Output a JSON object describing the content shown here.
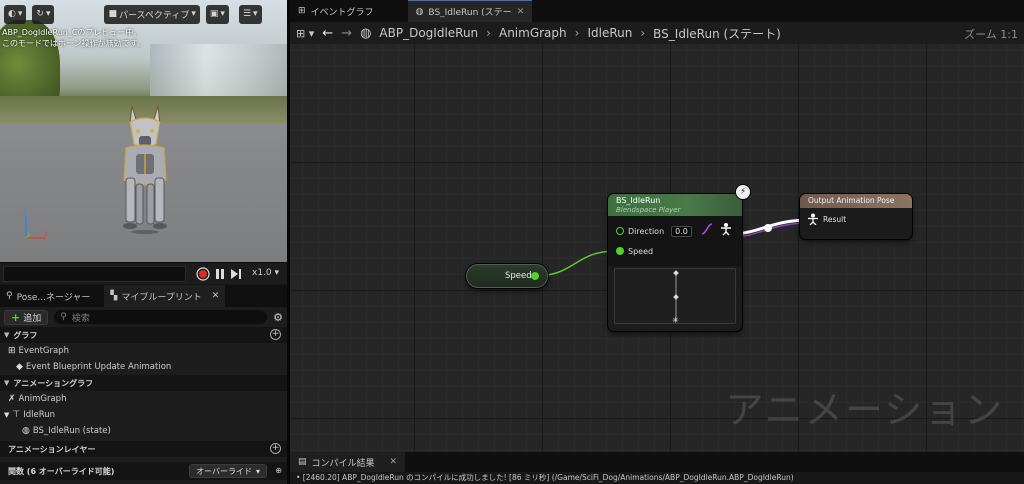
{
  "viewport": {
    "perspective_label": "パースペクティブ",
    "info_line1": "ABP_DogIdleRun_Cのプレビュー中。",
    "info_line2": "このモードではボーン操作が無効です。",
    "playback_speed": "x1.0",
    "axis_z": "Z",
    "axis_x": "X"
  },
  "left_tabs": [
    {
      "label": "Pose...ネージャー"
    },
    {
      "label": "マイブループリント",
      "close": "✕"
    }
  ],
  "my_blueprint": {
    "add_label": "追加",
    "search_placeholder": "検索",
    "sections": {
      "graph": "グラフ",
      "anim_graph": "アニメーショングラフ",
      "anim_layer": "アニメーションレイヤー",
      "functions": "関数 (6 オーバーライド可能)"
    },
    "items": {
      "event_graph": "EventGraph",
      "event_bp_update": "Event Blueprint Update Animation",
      "anim_graph": "AnimGraph",
      "idle_run": "IdleRun",
      "bs_state": "BS_IdleRun (state)"
    },
    "override_label": "オーバーライド"
  },
  "doc_tabs": [
    {
      "label": "イベントグラフ"
    },
    {
      "label": "BS_IdleRun (ステー",
      "close": "✕"
    }
  ],
  "breadcrumb": [
    "ABP_DogIdleRun",
    "AnimGraph",
    "IdleRun",
    "BS_IdleRun (ステート)"
  ],
  "zoom": "ズーム 1:1",
  "nodes": {
    "speed": "Speed",
    "blendspace_title": "BS_IdleRun",
    "blendspace_subtitle": "Blendspace Player",
    "direction_label": "Direction",
    "direction_value": "0.0",
    "speed_pin": "Speed",
    "output_title": "Output Animation Pose",
    "output_pin": "Result"
  },
  "watermark": "アニメーション",
  "compile": {
    "tab_label": "コンパイル結果",
    "close": "✕",
    "log": "• [2460.20] ABP_DogIdleRun のコンパイルに成功しました! [86 ミリ秒] (/Game/SciFi_Dog/Animations/ABP_DogIdleRun.ABP_DogIdleRun)"
  },
  "colors": {
    "exec_pin": "#52d12e",
    "node_header_green": "#497a48",
    "output_header": "#8b7461",
    "pose_wire": "#ffffff"
  }
}
